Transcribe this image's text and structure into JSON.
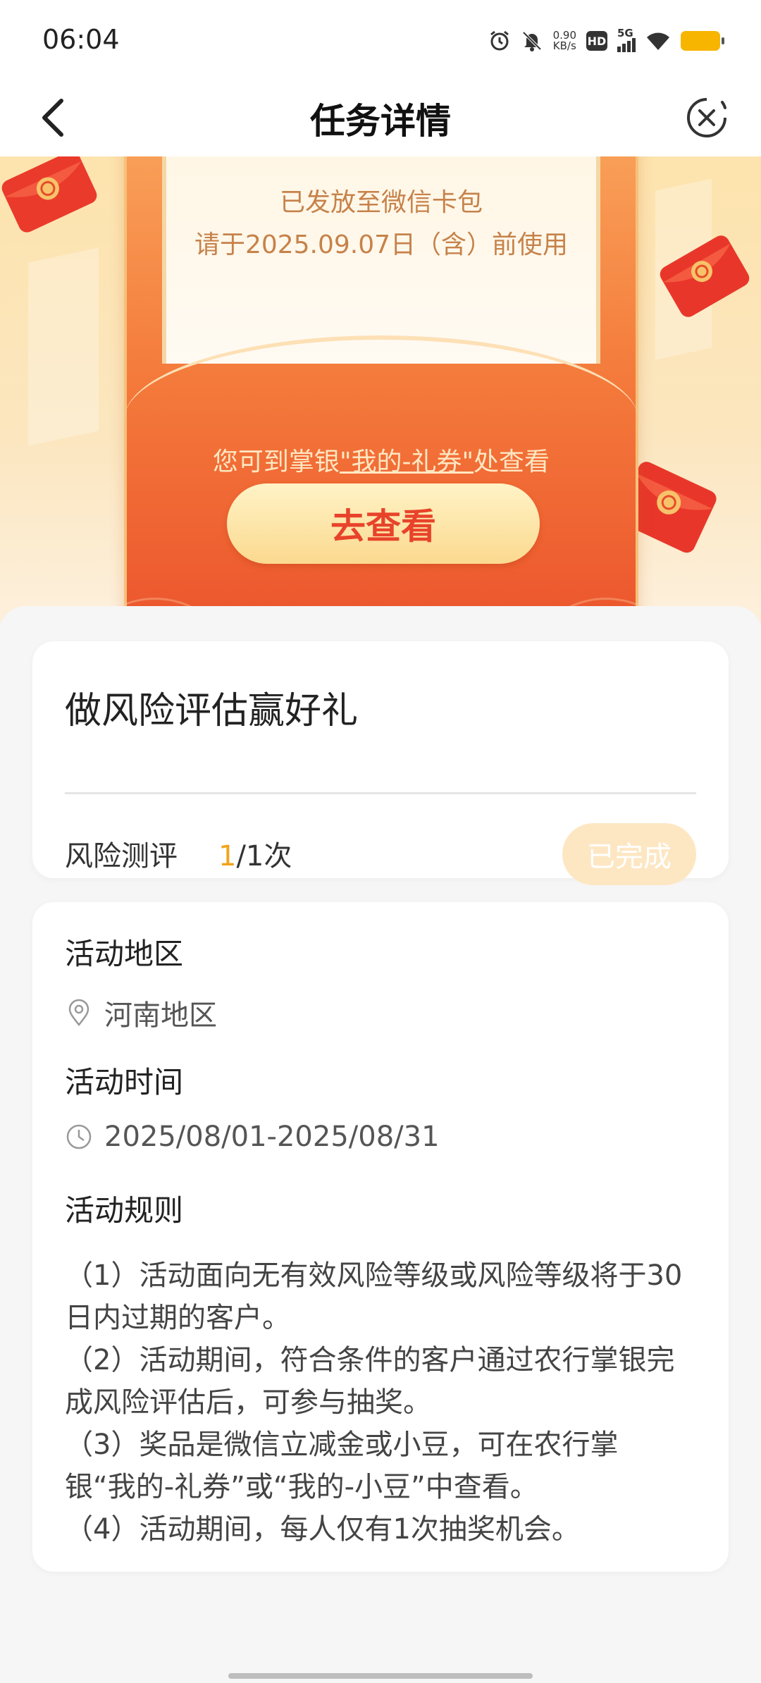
{
  "status_bar": {
    "time": "06:04",
    "net_speed_value": "0.90",
    "net_speed_unit": "KB/s",
    "hd_label": "HD",
    "network_label": "5G",
    "icons": [
      "alarm-icon",
      "mute-icon",
      "hd-icon",
      "signal-icon",
      "wifi-icon",
      "battery-icon"
    ],
    "battery_color": "#f7b500"
  },
  "nav": {
    "title": "任务详情",
    "back_icon": "chevron-left-icon",
    "close_icon": "close-circle-icon"
  },
  "hero": {
    "letter_line1": "已发放至微信卡包",
    "letter_line2": "请于2025.09.07日（含）前使用",
    "hint_prefix": "您可到掌银",
    "hint_link": "\"我的-礼券\"",
    "hint_suffix": "处查看",
    "button_label": "去查看",
    "accent_color": "#e8432a"
  },
  "task": {
    "title": "做风险评估赢好礼",
    "row_label": "风险测评",
    "progress_done": "1",
    "progress_total": "/1次",
    "status_button": "已完成",
    "highlight_color": "#f2a31a"
  },
  "info": {
    "region_heading": "活动地区",
    "region_value": "河南地区",
    "region_icon": "location-pin-icon",
    "time_heading": "活动时间",
    "time_value": "2025/08/01-2025/08/31",
    "time_icon": "clock-icon",
    "rules_heading": "活动规则",
    "rules": [
      "（1）活动面向无有效风险等级或风险等级将于30日内过期的客户。",
      "（2）活动期间，符合条件的客户通过农行掌银完成风险评估后，可参与抽奖。",
      "（3）奖品是微信立减金或小豆，可在农行掌银“我的-礼券”或“我的-小豆”中查看。",
      "（4）活动期间，每人仅有1次抽奖机会。"
    ]
  }
}
